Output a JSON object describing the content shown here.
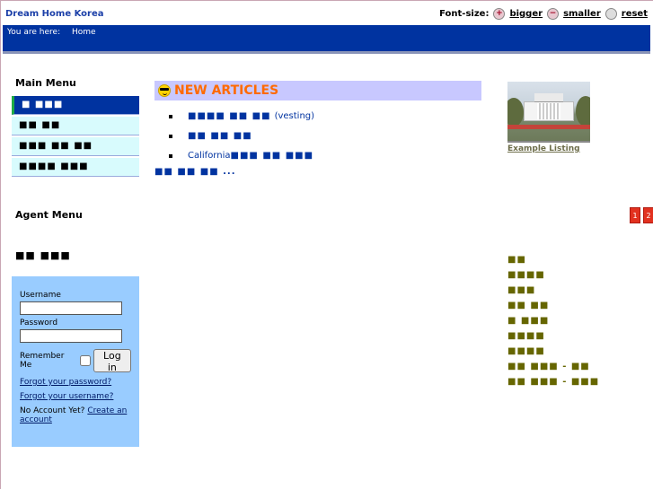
{
  "site": {
    "title": "Dream Home Korea"
  },
  "fontsize": {
    "label": "Font-size:",
    "bigger": "bigger",
    "smaller": "smaller",
    "reset": "reset"
  },
  "breadcrumb": {
    "prefix": "You are here:",
    "home": "Home"
  },
  "main_menu": {
    "title": "Main Menu",
    "items": [
      {
        "label": "■ ■■■",
        "active": true
      },
      {
        "label": "■■ ■■"
      },
      {
        "label": "■■■ ■■ ■■"
      },
      {
        "label": "■■■■ ■■■"
      }
    ]
  },
  "agent_menu": {
    "title": "Agent Menu",
    "text": "■■ ■■■"
  },
  "login": {
    "username_label": "Username",
    "username_value": "",
    "password_label": "Password",
    "password_value": "",
    "remember_label": "Remember Me",
    "button": "Log in",
    "forgot_password": "Forgot your password?",
    "forgot_username": "Forgot your username?",
    "no_account": "No Account Yet?",
    "create_account": "Create an account"
  },
  "articles": {
    "title": "NEW ARTICLES",
    "items": [
      {
        "kr": "■■■■ ■■ ■■",
        "suffix": "(vesting)"
      },
      {
        "kr": "■■ ■■ ■■",
        "suffix": ""
      },
      {
        "prefix": "California",
        "kr": "■■■ ■■ ■■■",
        "suffix": ""
      }
    ],
    "more": "■■ ■■ ■■ ..."
  },
  "listing": {
    "caption": "Example Listing"
  },
  "side_nav": [
    "1",
    "2"
  ],
  "categories": [
    "■■",
    "■■■■",
    "■■■",
    "■■ ■■",
    "■ ■■■",
    "■■■■",
    "■■■■",
    "■■ ■■■ - ■■",
    "■■ ■■■ - ■■■"
  ]
}
